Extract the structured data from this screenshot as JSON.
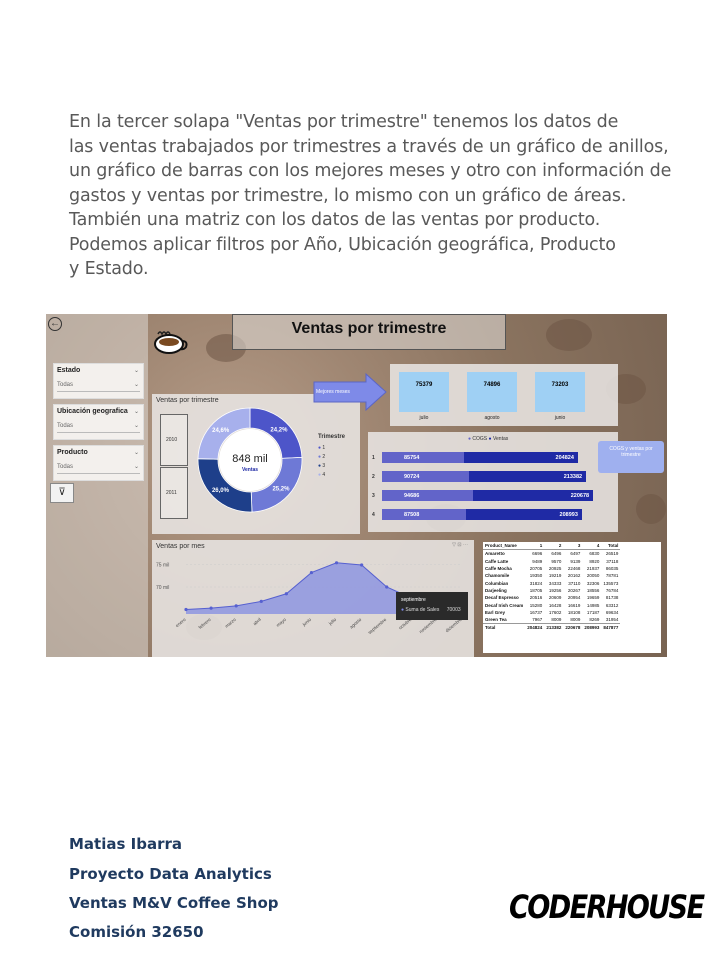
{
  "intro_lines": [
    "En la tercer solapa \"Ventas por trimestre\" tenemos los datos de",
    "las ventas trabajados por trimestres a través de un gráfico de anillos,",
    "un gráfico de barras con los mejores meses y otro con información de",
    "gastos y ventas por trimestre, lo mismo con un gráfico de áreas.",
    "También una matriz con los datos de las ventas por producto.",
    "Podemos aplicar filtros por Año, Ubicación geográfica, Producto",
    "y Estado."
  ],
  "dashboard": {
    "title": "Ventas por trimestre",
    "slicers": [
      {
        "label": "Estado",
        "value": "Todas"
      },
      {
        "label": "Ubicación geografica",
        "value": "Todas"
      },
      {
        "label": "Producto",
        "value": "Todas"
      }
    ],
    "icons": {
      "back": "back-arrow-icon",
      "filter": "clear-filter-icon",
      "coffee": "coffee-cup-icon"
    },
    "mejores_meses_label": "Mejores meses",
    "cogs_ventas_label": "COGS y ventas por trimestre",
    "years": [
      "2010",
      "2011"
    ]
  },
  "chart_data": [
    {
      "type": "pie",
      "title": "Ventas por trimestre",
      "center_value": "848 mil",
      "center_label": "Ventas",
      "legend_title": "Trimestre",
      "categories": [
        "1",
        "2",
        "3",
        "4"
      ],
      "values": [
        24.2,
        25.2,
        26.0,
        24.6
      ],
      "labels": [
        "24,2%",
        "25,2%",
        "26,0%",
        "24,6%"
      ],
      "colors": [
        "#4d55c9",
        "#6e79d6",
        "#1e3f8a",
        "#a7b0ec"
      ]
    },
    {
      "type": "bar",
      "title": "Mejores meses",
      "categories": [
        "julio",
        "agosto",
        "junio"
      ],
      "values": [
        75379,
        74896,
        73203
      ]
    },
    {
      "type": "bar",
      "title": "COGS y ventas por trimestre",
      "categories": [
        "1",
        "2",
        "3",
        "4"
      ],
      "legend": [
        "COGS",
        "Ventas"
      ],
      "series": [
        {
          "name": "COGS",
          "values": [
            85754,
            90724,
            94686,
            87508
          ]
        },
        {
          "name": "Ventas",
          "values": [
            204824,
            213382,
            220678,
            208993
          ]
        }
      ]
    },
    {
      "type": "area",
      "title": "Ventas por mes",
      "categories": [
        "enero",
        "febrero",
        "marzo",
        "abril",
        "mayo",
        "junio",
        "julio",
        "agosto",
        "septiembre",
        "octubre",
        "noviembre",
        "diciembre"
      ],
      "values": [
        65000,
        65300,
        65800,
        66800,
        68500,
        73203,
        75379,
        74896,
        70003,
        67500,
        66500,
        66200
      ],
      "y_ticks": [
        "75 mil",
        "70 mil"
      ],
      "ylim": [
        64000,
        76000
      ],
      "tooltip": {
        "title": "septiembre",
        "label": "Suma de Sales",
        "value": "70003"
      }
    },
    {
      "type": "table",
      "columns": [
        "Product_Name",
        "1",
        "2",
        "3",
        "4",
        "Total"
      ],
      "rows": [
        [
          "Amaretto",
          "6696",
          "6496",
          "6497",
          "6830",
          "26519"
        ],
        [
          "Caffe Latte",
          "9489",
          "9570",
          "9139",
          "8920",
          "37118"
        ],
        [
          "Caffe Mocha",
          "20705",
          "20925",
          "22468",
          "21937",
          "86035"
        ],
        [
          "Chamomile",
          "19350",
          "19219",
          "20162",
          "20050",
          "78781"
        ],
        [
          "Columbian",
          "31824",
          "34333",
          "37110",
          "32306",
          "135573"
        ],
        [
          "Darjeeling",
          "18705",
          "19256",
          "20267",
          "18556",
          "76784"
        ],
        [
          "Decaf Espresso",
          "20516",
          "20609",
          "20954",
          "19659",
          "81738"
        ],
        [
          "Decaf Irish Cream",
          "15280",
          "16428",
          "16619",
          "14985",
          "63312"
        ],
        [
          "Earl Grey",
          "16737",
          "17602",
          "18108",
          "17187",
          "69634"
        ],
        [
          "Green Tea",
          "7967",
          "8009",
          "8009",
          "8269",
          "31954"
        ]
      ],
      "total": [
        "Total",
        "204824",
        "213382",
        "220678",
        "208993",
        "847877"
      ]
    }
  ],
  "footer": {
    "author": "Matias Ibarra",
    "project": "Proyecto Data Analytics",
    "subject": "Ventas M&V Coffee Shop",
    "commission": "Comisión 32650",
    "logo": "CODERHOUSE"
  }
}
